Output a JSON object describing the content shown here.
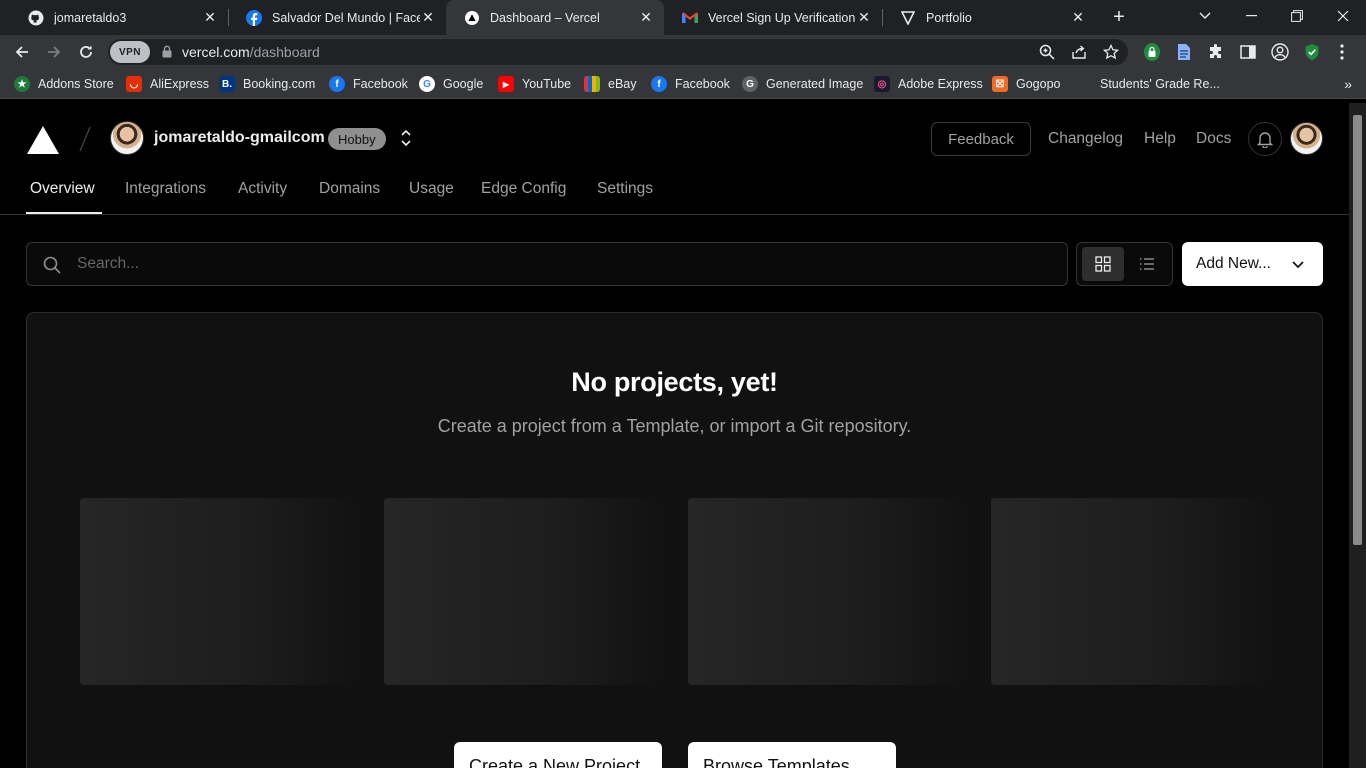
{
  "browser": {
    "tabs": [
      {
        "title": "jomaretaldo3",
        "icon": "github-icon",
        "active": false
      },
      {
        "title": "Salvador Del Mundo | Facebo",
        "icon": "facebook-icon",
        "active": false
      },
      {
        "title": "Dashboard – Vercel",
        "icon": "vercel-icon",
        "active": true
      },
      {
        "title": "Vercel Sign Up Verification (",
        "icon": "gmail-icon",
        "active": false
      },
      {
        "title": "Portfolio",
        "icon": "vercel-icon",
        "active": false
      }
    ],
    "vpn_label": "VPN",
    "url_host": "vercel.com",
    "url_path": "/dashboard",
    "bookmarks": [
      {
        "label": "Addons Store",
        "icon": "addons-store-icon"
      },
      {
        "label": "AliExpress",
        "icon": "aliexpress-icon"
      },
      {
        "label": "Booking.com",
        "icon": "booking-icon"
      },
      {
        "label": "Facebook",
        "icon": "facebook-icon"
      },
      {
        "label": "Google",
        "icon": "google-icon"
      },
      {
        "label": "YouTube",
        "icon": "youtube-icon"
      },
      {
        "label": "eBay",
        "icon": "ebay-icon"
      },
      {
        "label": "Facebook",
        "icon": "facebook-icon"
      },
      {
        "label": "Generated Image",
        "icon": "generated-image-icon"
      },
      {
        "label": "Adobe Express",
        "icon": "adobe-express-icon"
      },
      {
        "label": "Gogopo",
        "icon": "gogopo-icon"
      },
      {
        "label": "Students' Grade Re...",
        "icon": ""
      }
    ]
  },
  "header": {
    "account_name": "jomaretaldo-gmailcom",
    "plan": "Hobby",
    "feedback": "Feedback",
    "links": [
      "Changelog",
      "Help",
      "Docs"
    ]
  },
  "nav": {
    "tabs": [
      "Overview",
      "Integrations",
      "Activity",
      "Domains",
      "Usage",
      "Edge Config",
      "Settings"
    ],
    "active": "Overview"
  },
  "search": {
    "placeholder": "Search..."
  },
  "add_new": "Add New...",
  "empty_state": {
    "title": "No projects, yet!",
    "subtitle": "Create a project from a Template, or import a Git repository.",
    "primary_button": "Create a New Project",
    "secondary_button": "Browse Templates"
  },
  "colors": {
    "background": "#000000",
    "card": "#111111",
    "accent": "#ffffff",
    "badge": "#8f8f8f"
  }
}
